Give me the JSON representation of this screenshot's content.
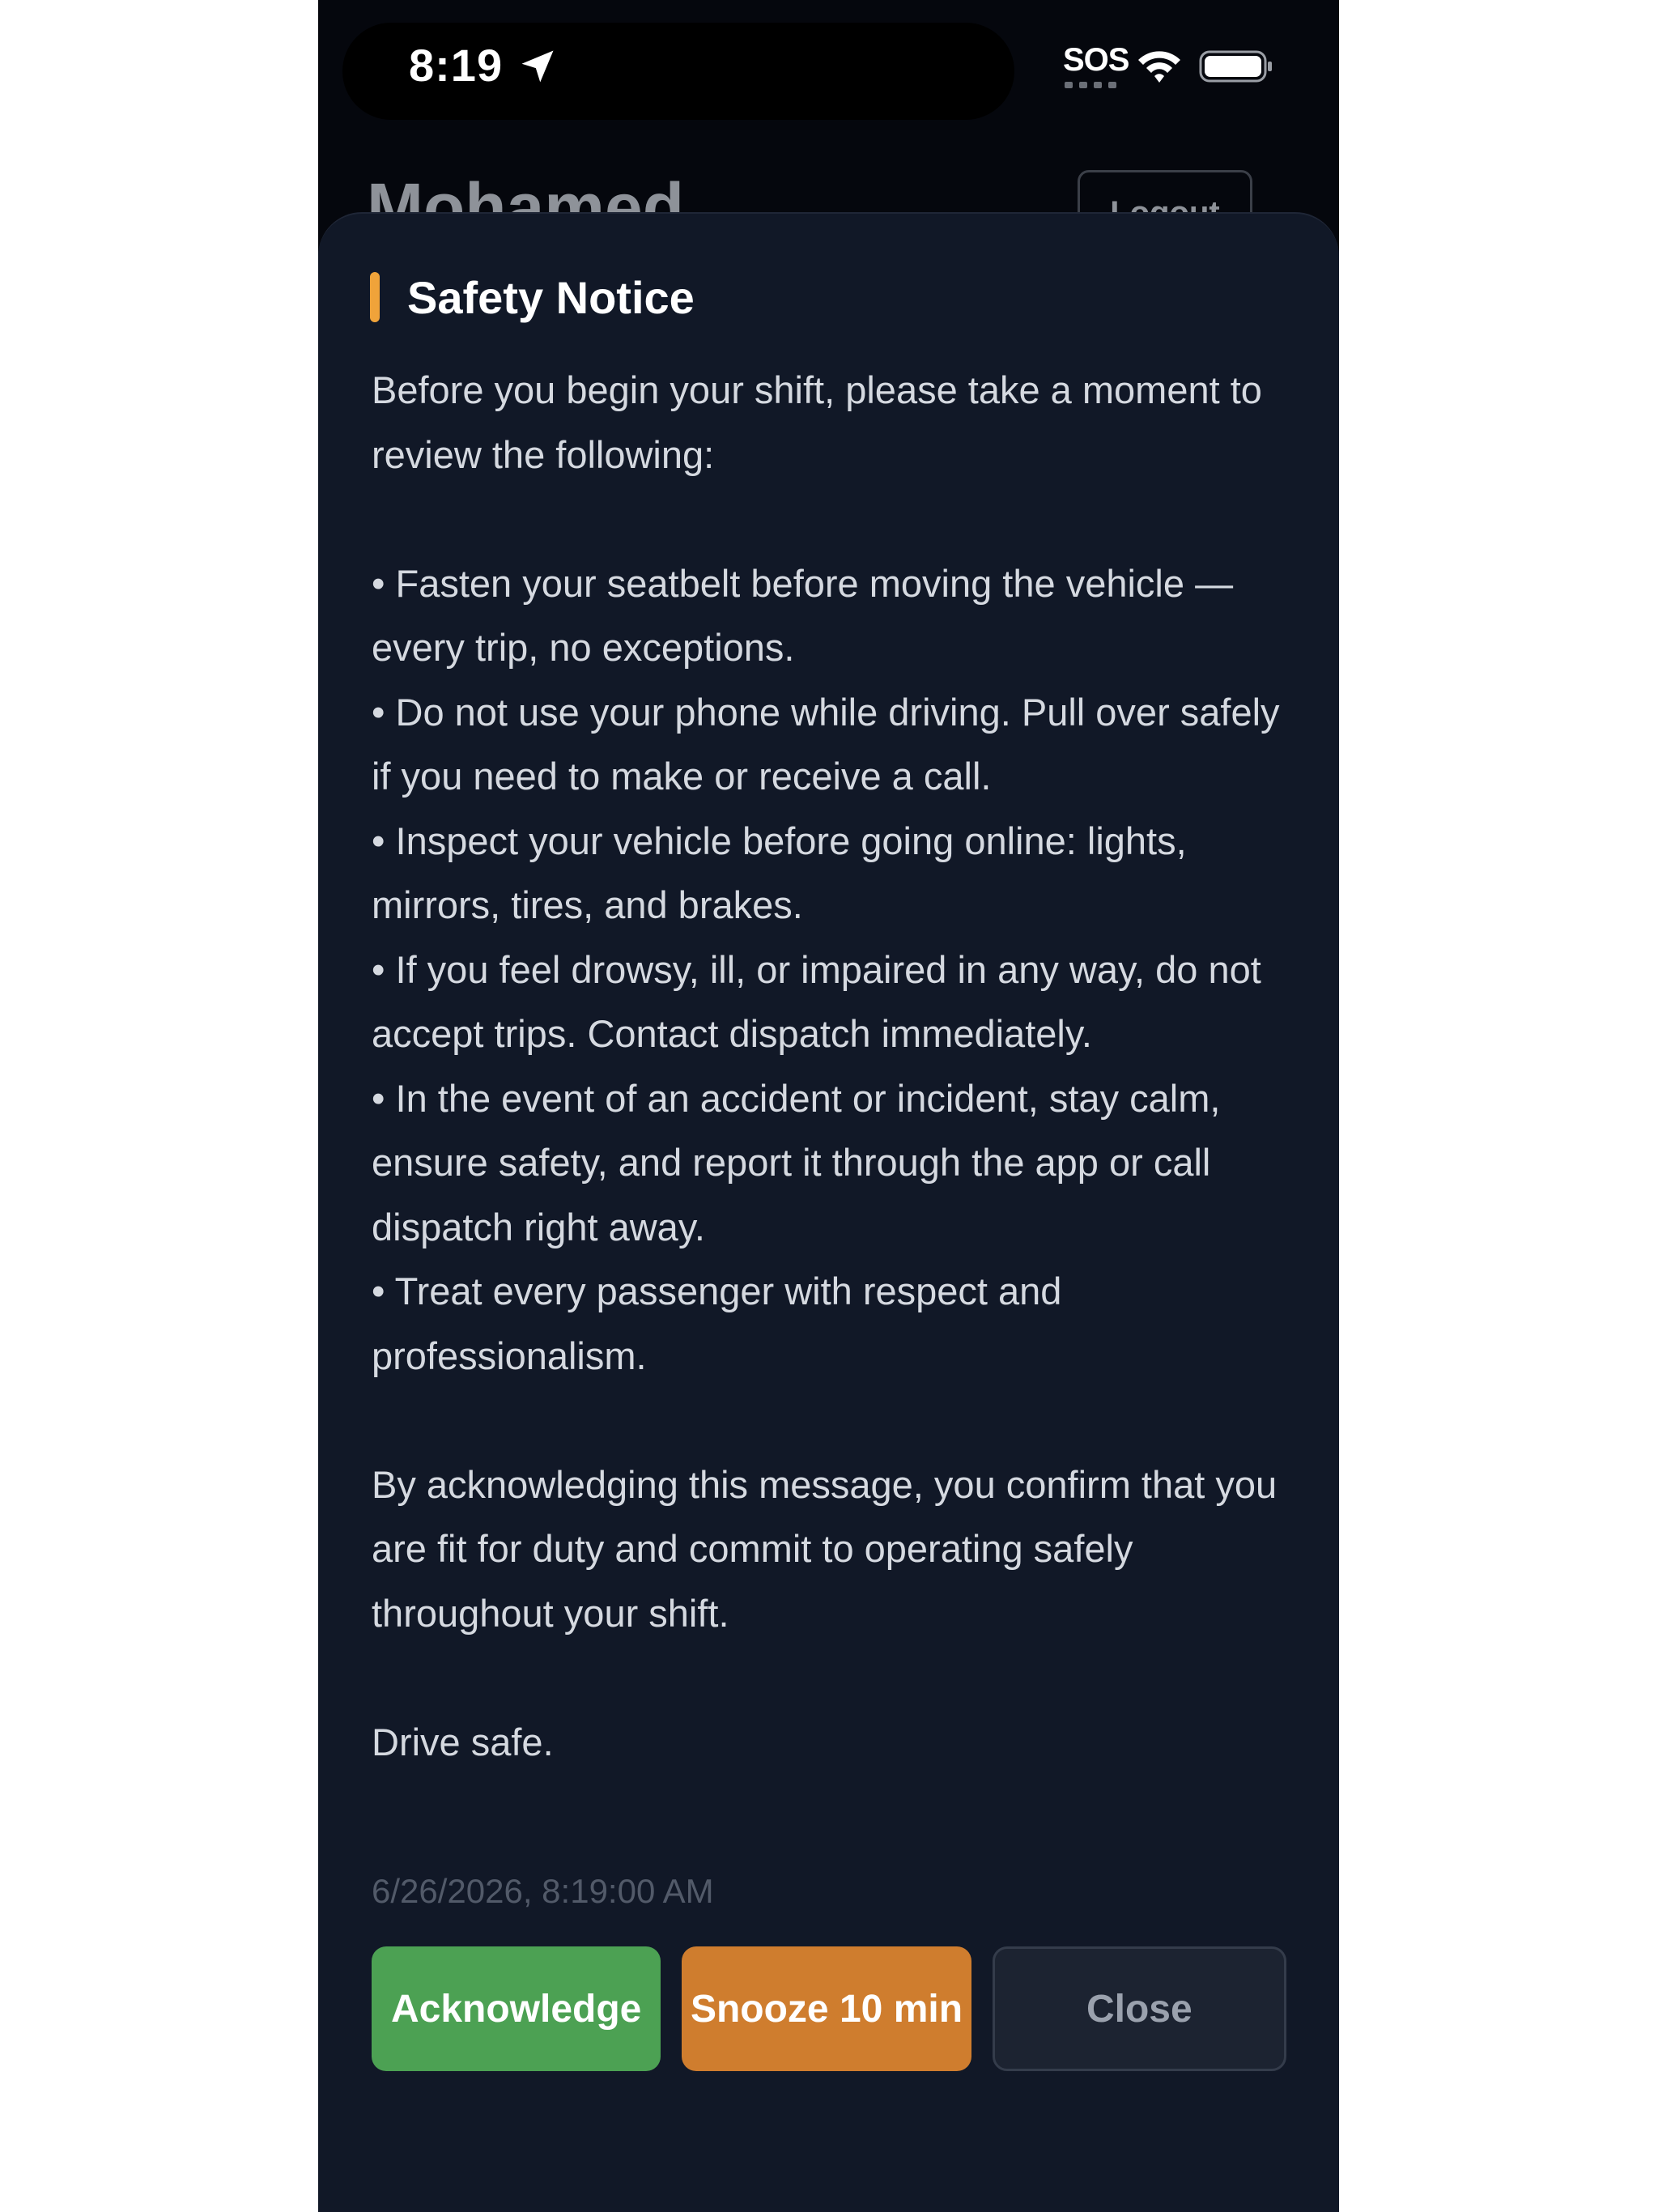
{
  "status_bar": {
    "time": "8:19",
    "sos_label": "SOS"
  },
  "background": {
    "title_partial": "Mohamed",
    "button_partial": "Logout"
  },
  "notice": {
    "title": "Safety Notice",
    "accent_color": "#f0a33a",
    "intro": "Before you begin your shift, please take a moment to review the following:",
    "bullets": [
      "• Fasten your seatbelt before moving the vehicle — every trip, no exceptions.",
      "• Do not use your phone while driving. Pull over safely if you need to make or receive a call.",
      "• Inspect your vehicle before going online: lights, mirrors, tires, and brakes.",
      "• If you feel drowsy, ill, or impaired in any way, do not accept trips. Contact dispatch immediately.",
      "• In the event of an accident or incident, stay calm, ensure safety, and report it through the app or call dispatch right away.",
      "• Treat every passenger with respect and professionalism."
    ],
    "confirmation": "By acknowledging this message, you confirm that you are fit for duty and commit to operating safely throughout your shift.",
    "signoff": "Drive safe.",
    "timestamp": "6/26/2026, 8:19:00 AM"
  },
  "actions": {
    "acknowledge_label": "Acknowledge",
    "snooze_label": "Snooze 10 min",
    "close_label": "Close",
    "acknowledge_color": "#4ca153",
    "snooze_color": "#cf7d2e"
  }
}
